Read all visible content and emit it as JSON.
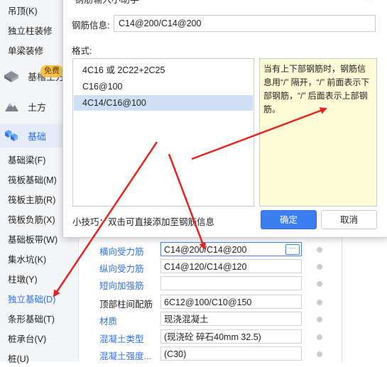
{
  "sidebar": {
    "items_top": [
      "吊顶(K)",
      "独立柱装修",
      "单梁装修"
    ],
    "categories": [
      {
        "label": "基槽土方",
        "icon": "foundation-pit-icon"
      },
      {
        "label": "土方",
        "icon": "earthwork-icon"
      },
      {
        "label": "基础",
        "icon": "foundation-blocks-icon"
      }
    ],
    "badge": "免费",
    "items": [
      "基础梁(F)",
      "筏板基础(M)",
      "筏板主筋(R)",
      "筏板负筋(X)",
      "基础板带(W)",
      "集水坑(K)",
      "柱墩(Y)",
      "独立基础(D)",
      "条形基础(T)",
      "桩承台(V)",
      "桩(U)"
    ],
    "active_item": "独立基础(D)"
  },
  "dialog": {
    "title": "钢筋输入小助手",
    "close_icon": "close-icon",
    "info_label": "钢筋信息:",
    "info_value": "C14@200/C14@200",
    "format_label": "格式:",
    "formats": [
      "4C16 或 2C22+2C25",
      "C16@100",
      "4C14/C16@100"
    ],
    "selected_format": "4C14/C16@100",
    "hint": "当有上下部钢筋时，钢筋信息用“/” 隔开，“/” 前面表示下部钢筋，“/” 后面表示上部钢筋。",
    "tip": "小技巧：双击可直接添加至钢筋信息",
    "ok_label": "确定",
    "cancel_label": "取消"
  },
  "properties": [
    {
      "name": "横向受力筋",
      "value": "C14@200/C14@200",
      "blue": true,
      "focused": true
    },
    {
      "name": "纵向受力筋",
      "value": "C14@120/C14@120",
      "blue": true,
      "focused": false
    },
    {
      "name": "短向加强筋",
      "value": "",
      "blue": true,
      "focused": false
    },
    {
      "name": "顶部柱间配筋",
      "value": "6C12@100/C10@150",
      "blue": false,
      "focused": false
    },
    {
      "name": "材质",
      "value": "现浇混凝土",
      "blue": true,
      "focused": false
    },
    {
      "name": "混凝土类型",
      "value": "(现浇砼 碎石40mm 32.5)",
      "blue": true,
      "focused": false
    },
    {
      "name": "混凝土强度...",
      "value": "(C30)",
      "blue": true,
      "focused": false
    }
  ],
  "colors": {
    "accent": "#2f6fe6",
    "arrow": "#e8231d",
    "hint_bg": "#fdfcd6",
    "ok_button": "#3a7ef0"
  }
}
